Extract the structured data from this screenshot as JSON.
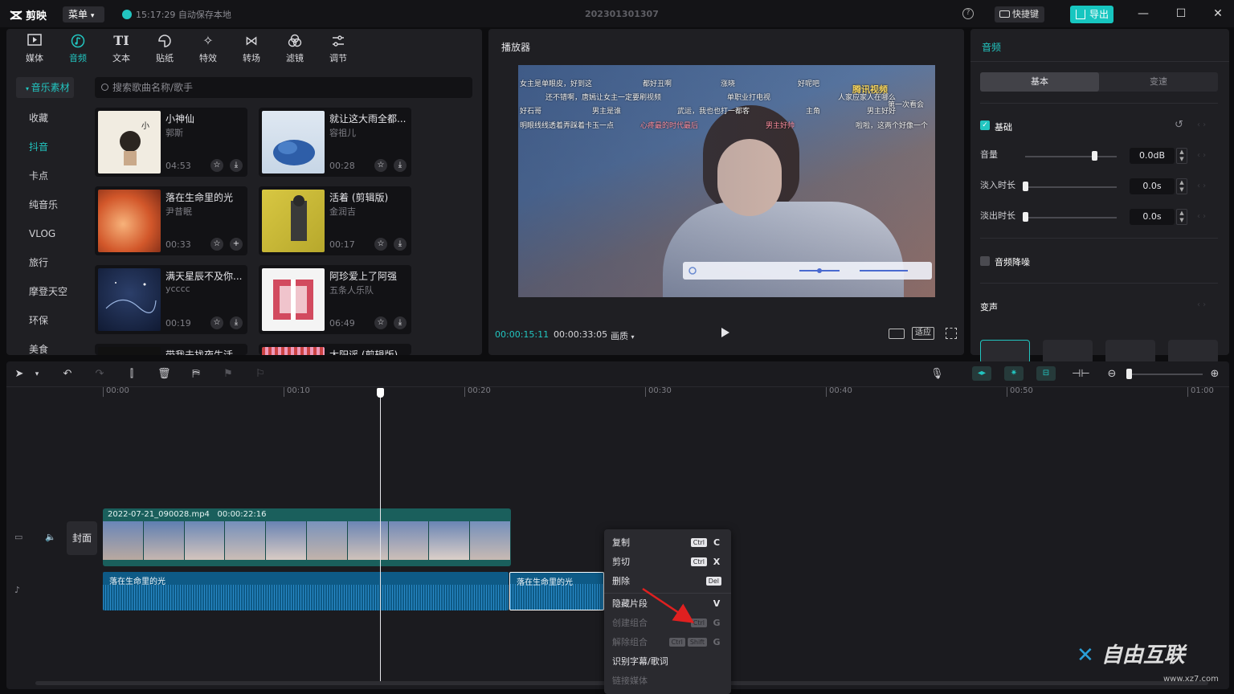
{
  "app": {
    "name": "剪映",
    "menu_label": "菜单",
    "autosave": "15:17:29 自动保存本地",
    "project_name": "202301301307",
    "shortcut_label": "快捷键",
    "export_label": "导出"
  },
  "toolbar": {
    "tabs": [
      {
        "label": "媒体",
        "icon": "media-icon"
      },
      {
        "label": "音频",
        "icon": "audio-icon"
      },
      {
        "label": "文本",
        "icon": "text-icon"
      },
      {
        "label": "贴纸",
        "icon": "sticker-icon"
      },
      {
        "label": "特效",
        "icon": "effects-icon"
      },
      {
        "label": "转场",
        "icon": "transition-icon"
      },
      {
        "label": "滤镜",
        "icon": "filter-icon"
      },
      {
        "label": "调节",
        "icon": "adjust-icon"
      }
    ],
    "active_tab": "音频",
    "text_tab_glyph": "TI"
  },
  "media": {
    "categories": [
      "音乐素材",
      "收藏",
      "抖音",
      "卡点",
      "纯音乐",
      "VLOG",
      "旅行",
      "摩登天空",
      "环保",
      "美食"
    ],
    "active_category": "抖音",
    "search_placeholder": "搜索歌曲名称/歌手",
    "songs": [
      {
        "title": "小神仙",
        "artist": "郭斯",
        "duration": "04:53",
        "action": "download"
      },
      {
        "title": "就让这大雨全都...",
        "artist": "容祖儿",
        "duration": "00:28",
        "action": "download"
      },
      {
        "title": "落在生命里的光",
        "artist": "尹昔眠",
        "duration": "00:33",
        "action": "add"
      },
      {
        "title": "活着 (剪辑版)",
        "artist": "金润吉",
        "duration": "00:17",
        "action": "download"
      },
      {
        "title": "满天星辰不及你...",
        "artist": "ycccc",
        "duration": "00:19",
        "action": "download"
      },
      {
        "title": "阿珍爱上了阿强",
        "artist": "五条人乐队",
        "duration": "06:49",
        "action": "download"
      },
      {
        "title": "带我去找夜生活",
        "artist": "",
        "duration": "",
        "action": ""
      },
      {
        "title": "太阳谣 (剪辑版)",
        "artist": "",
        "duration": "",
        "action": ""
      }
    ]
  },
  "player": {
    "title": "播放器",
    "current_time": "00:00:15:11",
    "total_time": "00:00:33:05",
    "quality_label": "画质",
    "fit_label": "适应",
    "danmu": [
      "女主是单眼皮，好到这",
      "都好丑啊",
      "涨晓",
      "好呢吧",
      "腾讯视频",
      "还不错啊，唐嫣让女主一定要刷视频",
      "单职业打电视",
      "人家应家人在哪么",
      "第一次看会",
      "好石哥",
      "男主是谁",
      "武运，我也也打一都客",
      "主角",
      "男主好好",
      "明眼线线透着弄踩着卡玉一点",
      "心疼最的时代最后",
      "男主好帅",
      "啦啦，这两个好像一个"
    ]
  },
  "props": {
    "title": "音频",
    "tabs": [
      "基本",
      "变速"
    ],
    "section_basic": "基础",
    "volume_label": "音量",
    "volume_value": "0.0dB",
    "volume_level": 0.75,
    "fade_in_label": "淡入时长",
    "fade_in_value": "0.0s",
    "fade_in_level": 0,
    "fade_out_label": "淡出时长",
    "fade_out_value": "0.0s",
    "fade_out_level": 0,
    "denoise_label": "音频降噪",
    "voice_change_label": "变声",
    "accent": "#22c5c0"
  },
  "timeline": {
    "ruler": [
      "00:00",
      "00:10",
      "00:20",
      "00:30",
      "00:40",
      "00:50",
      "01:00"
    ],
    "cover_label": "封面",
    "video_clip": {
      "name": "2022-07-21_090028.mp4",
      "duration": "00:00:22:16"
    },
    "audio_clips": [
      "落在生命里的光",
      "落在生命里的光"
    ]
  },
  "context_menu": {
    "items": [
      {
        "label": "复制",
        "keys": [
          "Ctrl"
        ],
        "letter": "C",
        "enabled": true
      },
      {
        "label": "剪切",
        "keys": [
          "Ctrl"
        ],
        "letter": "X",
        "enabled": true
      },
      {
        "label": "删除",
        "keys": [
          "Del"
        ],
        "letter": "",
        "enabled": true
      },
      {
        "label": "隐藏片段",
        "keys": [],
        "letter": "V",
        "enabled": true
      },
      {
        "label": "创建组合",
        "keys": [
          "Ctrl"
        ],
        "letter": "G",
        "enabled": false
      },
      {
        "label": "解除组合",
        "keys": [
          "Ctrl",
          "Shift"
        ],
        "letter": "G",
        "enabled": false
      },
      {
        "label": "识别字幕/歌词",
        "keys": [],
        "letter": "",
        "enabled": true
      },
      {
        "label": "链接媒体",
        "keys": [],
        "letter": "",
        "enabled": false
      }
    ]
  },
  "watermark": {
    "main": "自由互联",
    "sub": "www.xz7.com"
  }
}
